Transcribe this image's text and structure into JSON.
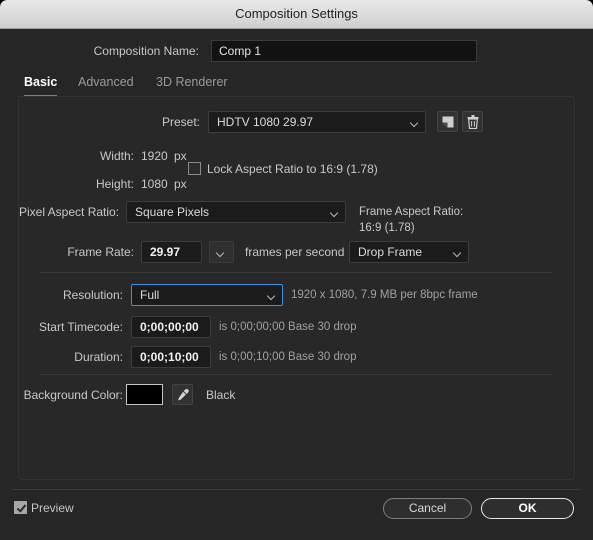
{
  "window": {
    "title": "Composition Settings"
  },
  "composition_name": {
    "label": "Composition Name:",
    "value": "Comp 1"
  },
  "tabs": [
    {
      "label": "Basic",
      "active": true
    },
    {
      "label": "Advanced",
      "active": false
    },
    {
      "label": "3D Renderer",
      "active": false
    }
  ],
  "basic": {
    "preset": {
      "label": "Preset:",
      "value": "HDTV 1080 29.97",
      "save_icon": "save-preset-icon",
      "delete_icon": "trash-icon"
    },
    "width": {
      "label": "Width:",
      "value": "1920",
      "unit": "px"
    },
    "height": {
      "label": "Height:",
      "value": "1080",
      "unit": "px"
    },
    "lock_aspect": {
      "label": "Lock Aspect Ratio to 16:9 (1.78)",
      "checked": false
    },
    "pixel_aspect_ratio": {
      "label": "Pixel Aspect Ratio:",
      "value": "Square Pixels"
    },
    "frame_aspect_ratio": {
      "label": "Frame Aspect Ratio:",
      "value": "16:9 (1.78)"
    },
    "frame_rate": {
      "label": "Frame Rate:",
      "value": "29.97",
      "unit": "frames per second",
      "drop_mode": "Drop Frame"
    },
    "resolution": {
      "label": "Resolution:",
      "value": "Full",
      "info": "1920 x 1080, 7.9 MB per 8bpc frame"
    },
    "start_timecode": {
      "label": "Start Timecode:",
      "value": "0;00;00;00",
      "info": "is 0;00;00;00  Base 30  drop"
    },
    "duration": {
      "label": "Duration:",
      "value": "0;00;10;00",
      "info": "is 0;00;10;00  Base 30  drop"
    },
    "background_color": {
      "label": "Background Color:",
      "swatch_hex": "#000000",
      "eyedropper_icon": "eyedropper-icon",
      "name": "Black"
    }
  },
  "footer": {
    "preview": {
      "label": "Preview",
      "checked": true
    },
    "cancel_label": "Cancel",
    "ok_label": "OK"
  },
  "colors": {
    "dialog_bg": "#262626",
    "accent_blue": "#3b8fe0",
    "field_bg": "#1b1b1b"
  }
}
